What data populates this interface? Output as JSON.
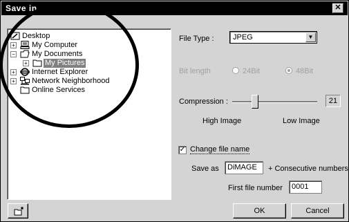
{
  "window": {
    "title": "Save in",
    "close_glyph": "✕"
  },
  "tree": {
    "items": [
      {
        "label": "Desktop",
        "icon": "desktop-icon",
        "expander": ""
      },
      {
        "label": "My Computer",
        "icon": "computer-icon",
        "expander": "+"
      },
      {
        "label": "My Documents",
        "icon": "folder-open-icon",
        "expander": "−"
      },
      {
        "label": "My Pictures",
        "icon": "folder-icon",
        "expander": "+",
        "selected": true
      },
      {
        "label": "Internet Explorer",
        "icon": "internet-explorer-icon",
        "expander": "+"
      },
      {
        "label": "Network Neighborhood",
        "icon": "network-icon",
        "expander": "+"
      },
      {
        "label": "Online Services",
        "icon": "folder-icon",
        "expander": ""
      }
    ]
  },
  "file_type": {
    "label": "File Type :",
    "value": "JPEG"
  },
  "bit_length": {
    "label": "Bit length",
    "option_24": "24Bit",
    "option_48": "48Bit",
    "selected": "48Bit"
  },
  "compression": {
    "label": "Compression :",
    "value": "21",
    "level": 0.25,
    "left_label": "High Image",
    "right_label": "Low Image"
  },
  "change_name": {
    "label": "Change file name",
    "checked": true,
    "check_glyph": "✓"
  },
  "save_as": {
    "label": "Save as",
    "value": "DiMAGE",
    "suffix": "+ Consecutive numbers"
  },
  "first_number": {
    "label": "First file number",
    "value": "0001"
  },
  "buttons": {
    "ok": "OK",
    "cancel": "Cancel"
  },
  "colors": {
    "titlebar": "#000000",
    "face": "#d4d4d4",
    "selection": "#808080"
  }
}
